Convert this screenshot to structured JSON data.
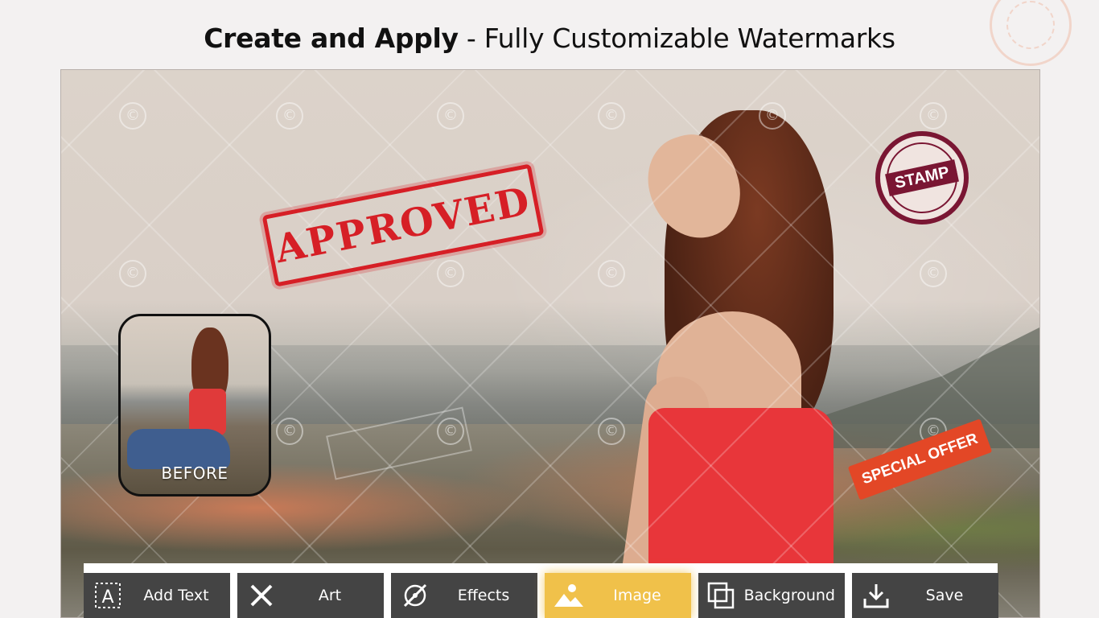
{
  "header": {
    "title_bold": "Create and Apply",
    "title_rest": " - Fully Customizable Watermarks"
  },
  "photo": {
    "stamps": {
      "approved": "APPROVED",
      "circle_stamp": "STAMP",
      "offer": "SPECIAL OFFER"
    },
    "before_label": "BEFORE"
  },
  "toolbar": {
    "items": [
      {
        "label": "Add Text",
        "icon": "add-text-icon"
      },
      {
        "label": "Art",
        "icon": "art-icon"
      },
      {
        "label": "Effects",
        "icon": "effects-icon"
      },
      {
        "label": "Image",
        "icon": "image-icon",
        "active": true
      },
      {
        "label": "Background",
        "icon": "background-icon"
      },
      {
        "label": "Save",
        "icon": "save-icon"
      }
    ]
  },
  "colors": {
    "toolbar_bg": "#444444",
    "active_bg": "#f0c14a",
    "approved_red": "#d61f26",
    "stamp_maroon": "#7a1633",
    "offer_orange": "#e34726"
  }
}
